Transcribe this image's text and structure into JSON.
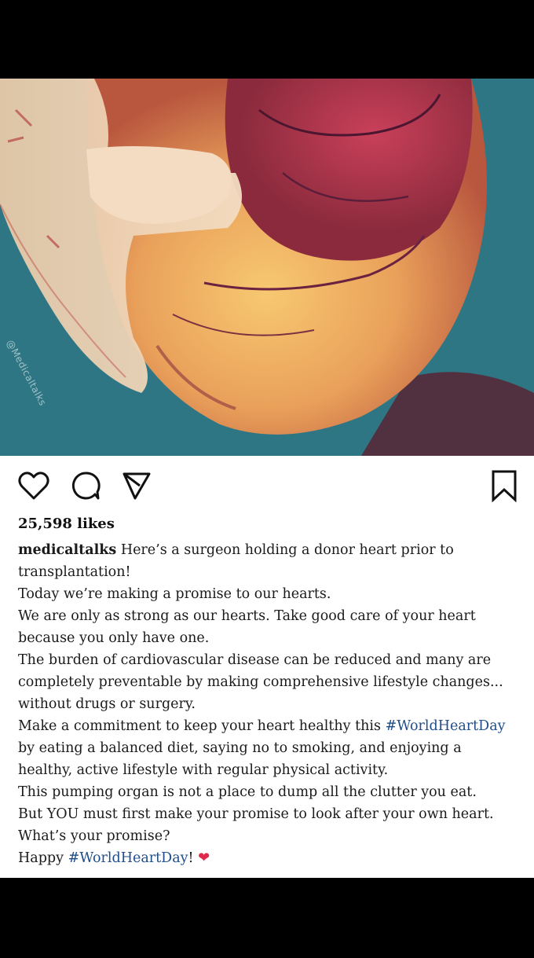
{
  "post": {
    "image_watermark": "@Medicaltalks",
    "likes": "25,598 likes",
    "username": "medicaltalks",
    "caption_lines": [
      "Here’s a surgeon holding a donor heart prior to",
      "transplantation!",
      "Today we’re making a promise to our hearts.",
      "We are only as strong as our hearts. Take good care of your heart",
      "because you only have one.",
      "The burden of cardiovascular disease can be reduced and many are",
      "completely preventable by making comprehensive lifestyle changes...",
      "without drugs or surgery.",
      "Make a commitment to keep your heart healthy this ",
      "by eating a balanced diet, saying no to smoking, and enjoying a",
      "healthy, active lifestyle with regular physical activity.",
      "This pumping organ is not a place to dump all the clutter you eat.",
      "But YOU must first make your promise to look after your own heart.",
      "What’s your promise?",
      "Happy "
    ],
    "hashtag": "#WorldHeartDay",
    "hashtag_end": "#WorldHeartDay",
    "end_punct": "!",
    "emoji": "❤"
  },
  "icons": [
    "heart-icon",
    "comment-icon",
    "share-icon",
    "bookmark-icon"
  ],
  "colors": {
    "hashtag": "#1f4d8a",
    "emoji": "#e0284a"
  }
}
